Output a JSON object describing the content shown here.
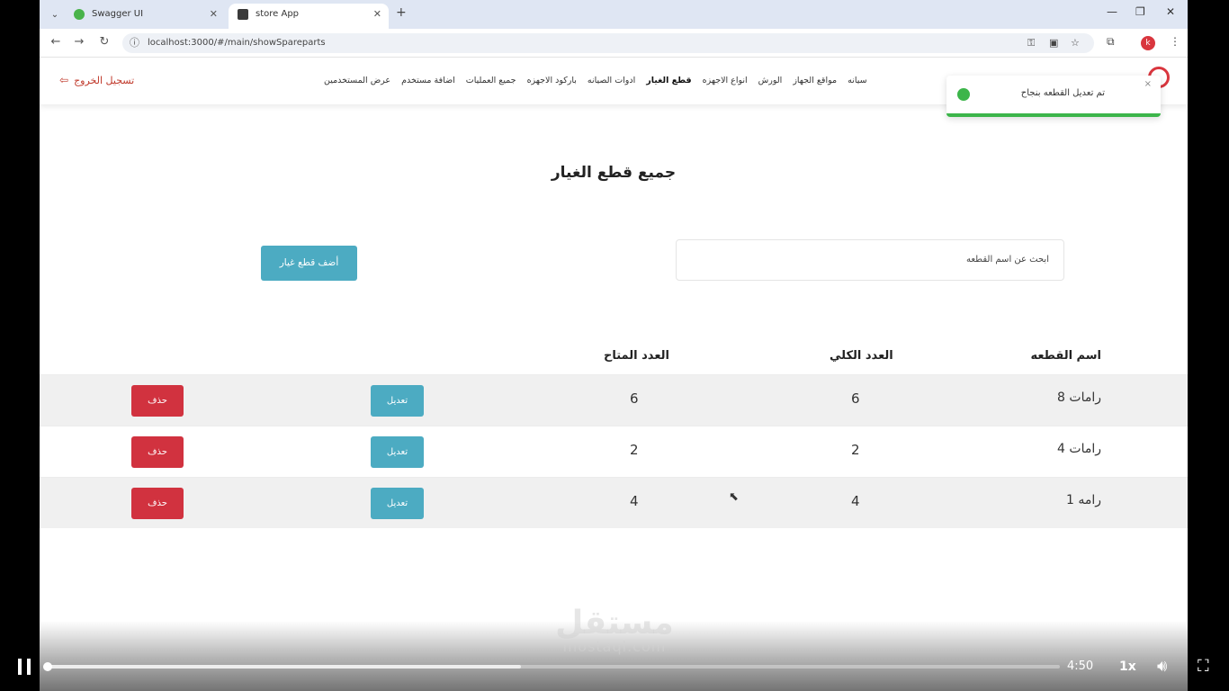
{
  "browser": {
    "tabs": [
      {
        "title": "Swagger UI",
        "favicon": "swagger-icon"
      },
      {
        "title": "store App",
        "favicon": "app-icon"
      }
    ],
    "url": "localhost:3000/#/main/showSpareparts",
    "profile_initial": "k"
  },
  "navbar": {
    "logout_label": "تسجيل الخروج",
    "links": [
      "سيانه",
      "مواقع الجهاز",
      "الورش",
      "انواع الاجهزه",
      "قطع الغيار",
      "ادوات الصيانه",
      "باركود الاجهزه",
      "جميع العمليات",
      "اضافة مستخدم",
      "عرض المستخدمين"
    ],
    "active_link": "قطع الغيار"
  },
  "toast": {
    "message": "تم تعديل القطعه بنجاح",
    "close": "×",
    "status_color": "#3cb54a"
  },
  "page": {
    "title": "جميع قطع الغيار",
    "search_placeholder": "ابحث عن اسم القطعه",
    "add_button": "أضف قطع غيار"
  },
  "table": {
    "headers": {
      "name": "اسم القطعه",
      "total": "العدد الكلي",
      "available": "العدد المتاح"
    },
    "rows": [
      {
        "name": "رامات 8",
        "total": "6",
        "available": "6",
        "edit": "تعديل",
        "delete": "حذف"
      },
      {
        "name": "رامات 4",
        "total": "2",
        "available": "2",
        "edit": "تعديل",
        "delete": "حذف"
      },
      {
        "name": "رامه 1",
        "total": "4",
        "available": "4",
        "edit": "تعديل",
        "delete": "حذف"
      }
    ]
  },
  "player": {
    "time": "4:50",
    "speed": "1x",
    "progress": 0.47,
    "watermark_ar": "مستقل",
    "watermark_latin": "mostaql.com"
  },
  "colors": {
    "primary": "#4cabc2",
    "danger": "#d1323f",
    "success": "#3cb54a"
  }
}
